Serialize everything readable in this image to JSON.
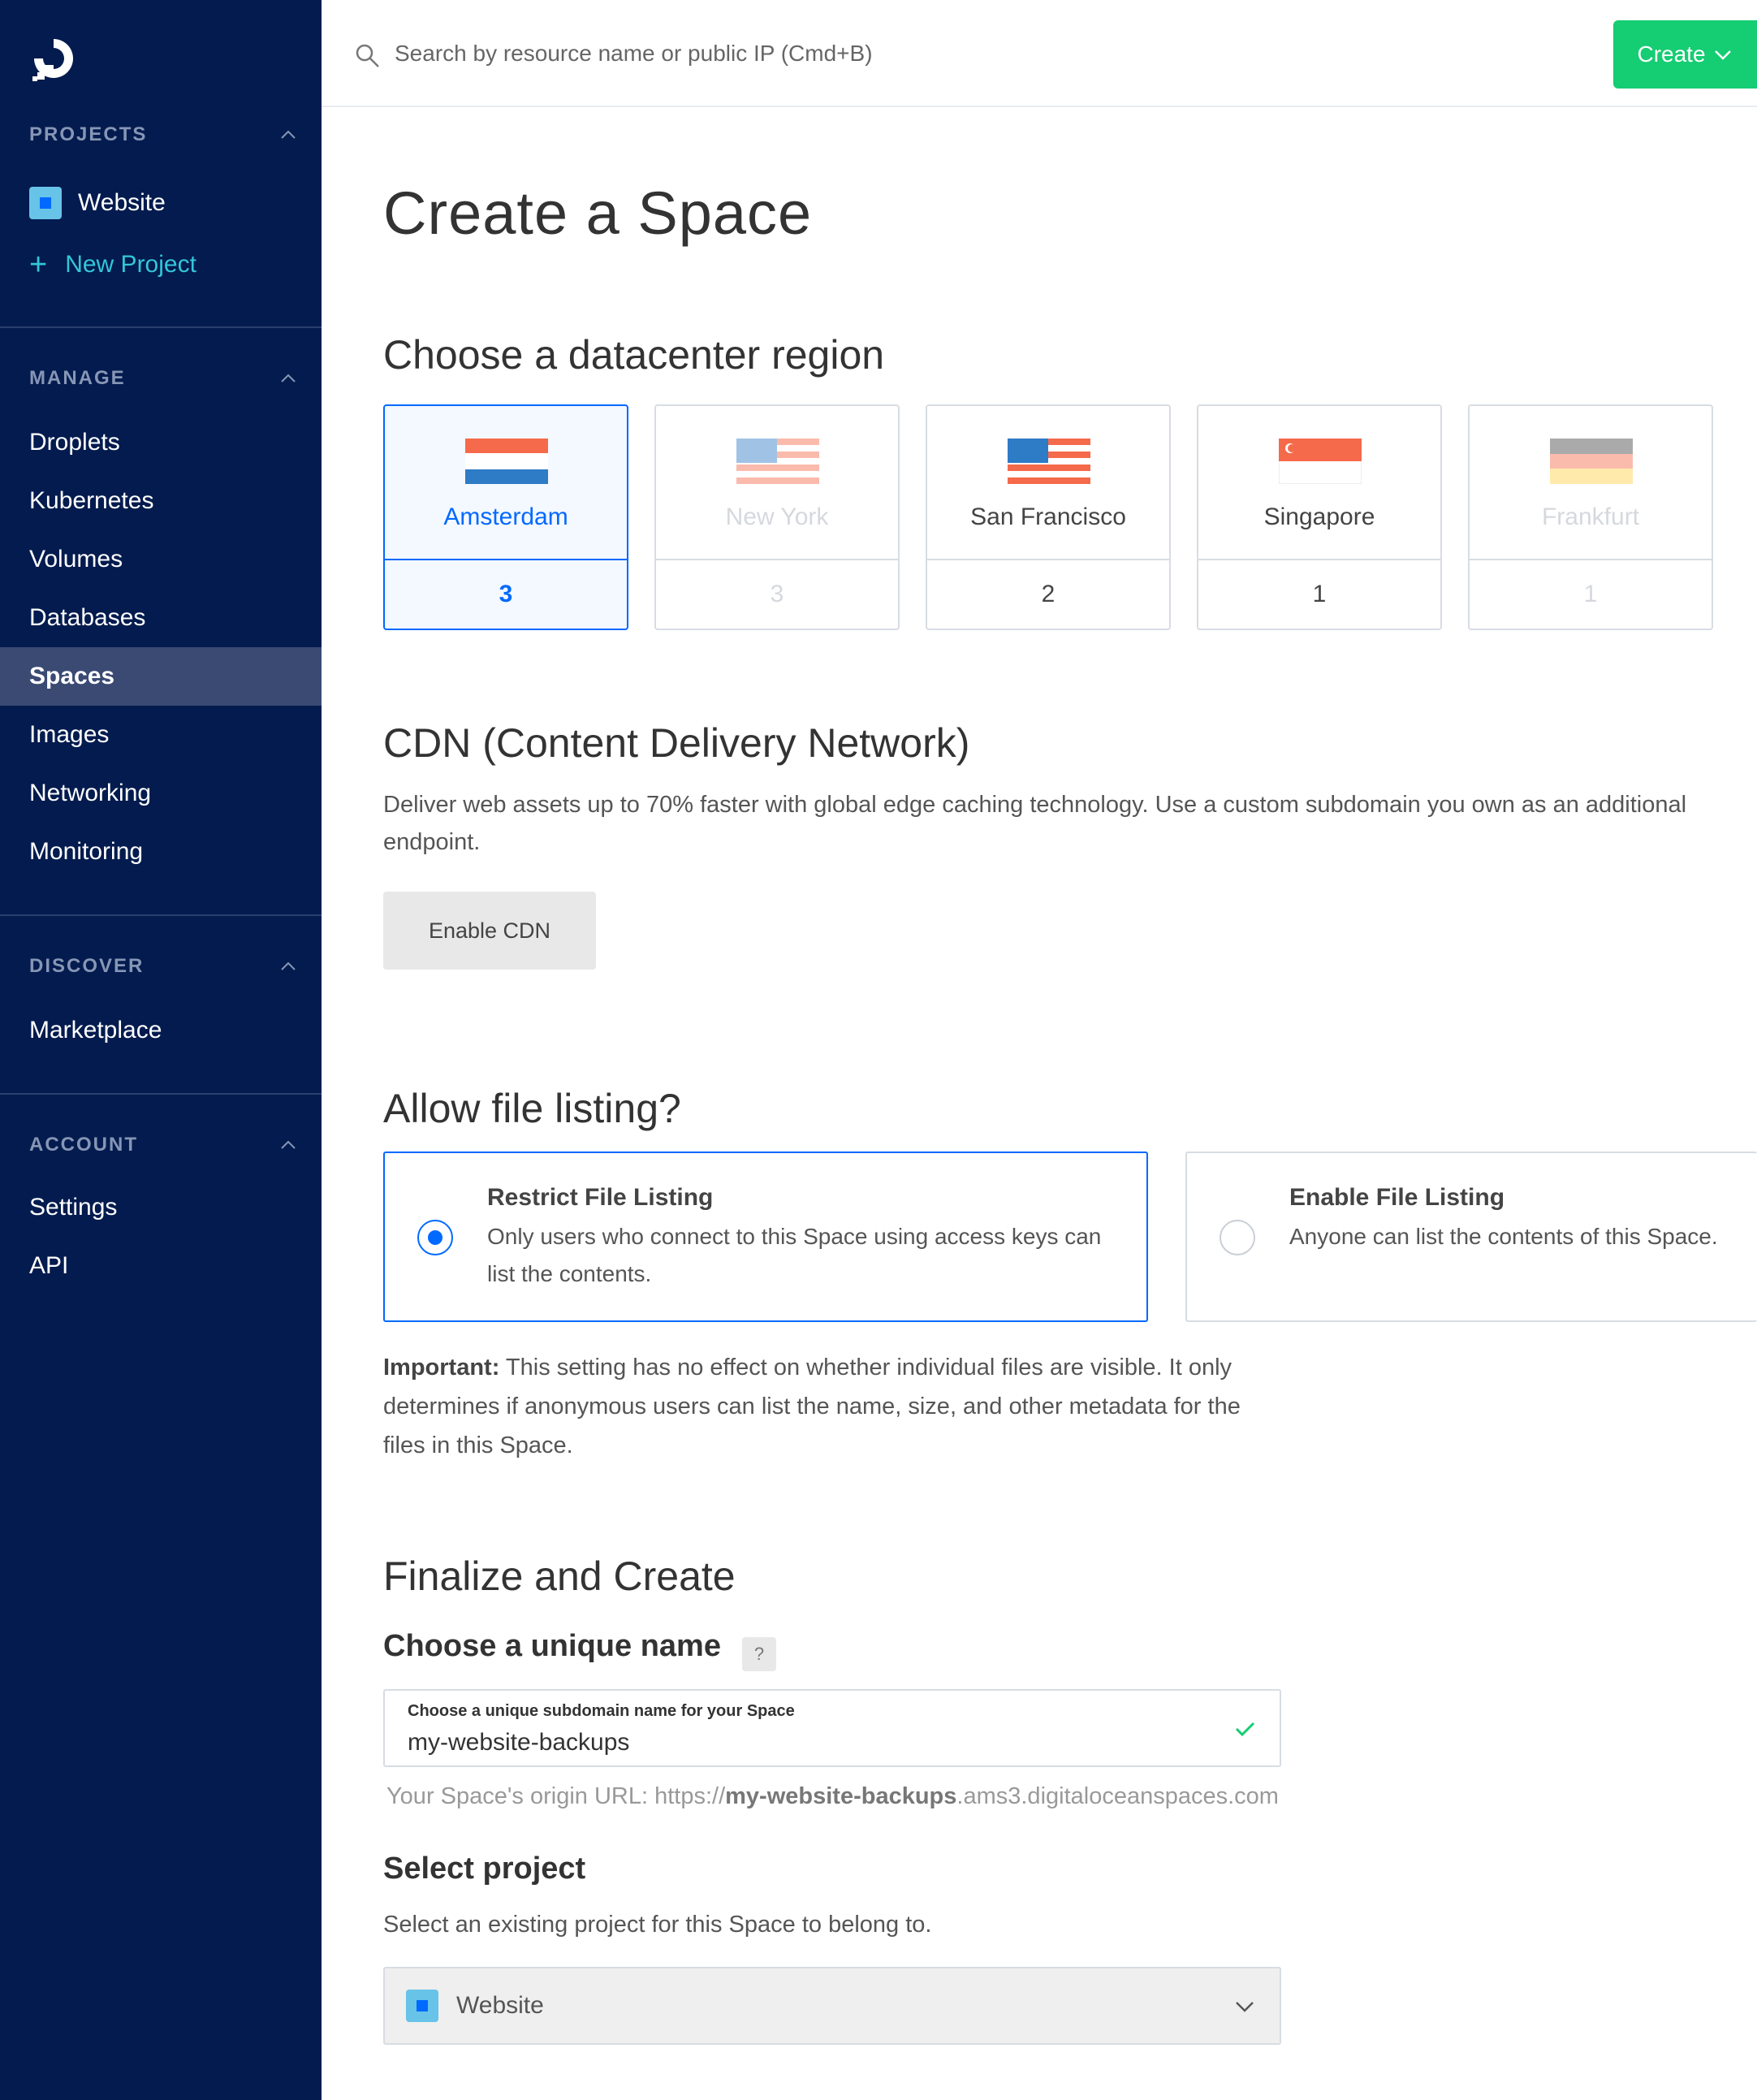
{
  "search": {
    "placeholder": "Search by resource name or public IP (Cmd+B)"
  },
  "topbar": {
    "create_label": "Create"
  },
  "sidebar": {
    "projects_heading": "PROJECTS",
    "project_name": "Website",
    "new_project_label": "New Project",
    "manage_heading": "MANAGE",
    "manage_items": [
      "Droplets",
      "Kubernetes",
      "Volumes",
      "Databases",
      "Spaces",
      "Images",
      "Networking",
      "Monitoring"
    ],
    "active_item": "Spaces",
    "discover_heading": "DISCOVER",
    "discover_items": [
      "Marketplace"
    ],
    "account_heading": "ACCOUNT",
    "account_items": [
      "Settings",
      "API"
    ]
  },
  "page": {
    "title": "Create a Space",
    "region_heading": "Choose a datacenter region",
    "regions": [
      {
        "name": "Amsterdam",
        "count": "3",
        "state": "selected"
      },
      {
        "name": "New York",
        "count": "3",
        "state": "disabled"
      },
      {
        "name": "San Francisco",
        "count": "2",
        "state": "available"
      },
      {
        "name": "Singapore",
        "count": "1",
        "state": "available"
      },
      {
        "name": "Frankfurt",
        "count": "1",
        "state": "disabled"
      }
    ],
    "cdn_heading": "CDN (Content Delivery Network)",
    "cdn_description": "Deliver web assets up to 70% faster with global edge caching technology. Use a custom subdomain you own as an additional endpoint.",
    "cdn_button": "Enable CDN",
    "listing_heading": "Allow file listing?",
    "listing_options": [
      {
        "title": "Restrict File Listing",
        "description": "Only users who connect to this Space using access keys can list the contents.",
        "selected": true
      },
      {
        "title": "Enable File Listing",
        "description": "Anyone can list the contents of this Space.",
        "selected": false
      }
    ],
    "important_label": "Important:",
    "important_text": " This setting has no effect on whether individual files are visible. It only determines if anonymous users can list the name, size, and other metadata for the files in this Space.",
    "finalize_heading": "Finalize and Create",
    "name_heading": "Choose a unique name",
    "help_label": "?",
    "name_field_label": "Choose a unique subdomain name for your Space",
    "name_value": "my-website-backups",
    "origin_prefix": "Your Space's origin URL: https://",
    "origin_name": "my-website-backups",
    "origin_suffix": ".ams3.digitaloceanspaces.com",
    "project_heading": "Select project",
    "project_description": "Select an existing project for this Space to belong to.",
    "project_selected": "Website"
  },
  "colors": {
    "sidebar_bg": "#031b4e",
    "accent_blue": "#0069ff",
    "create_green": "#15cd72",
    "new_project_teal": "#33c6d8"
  }
}
